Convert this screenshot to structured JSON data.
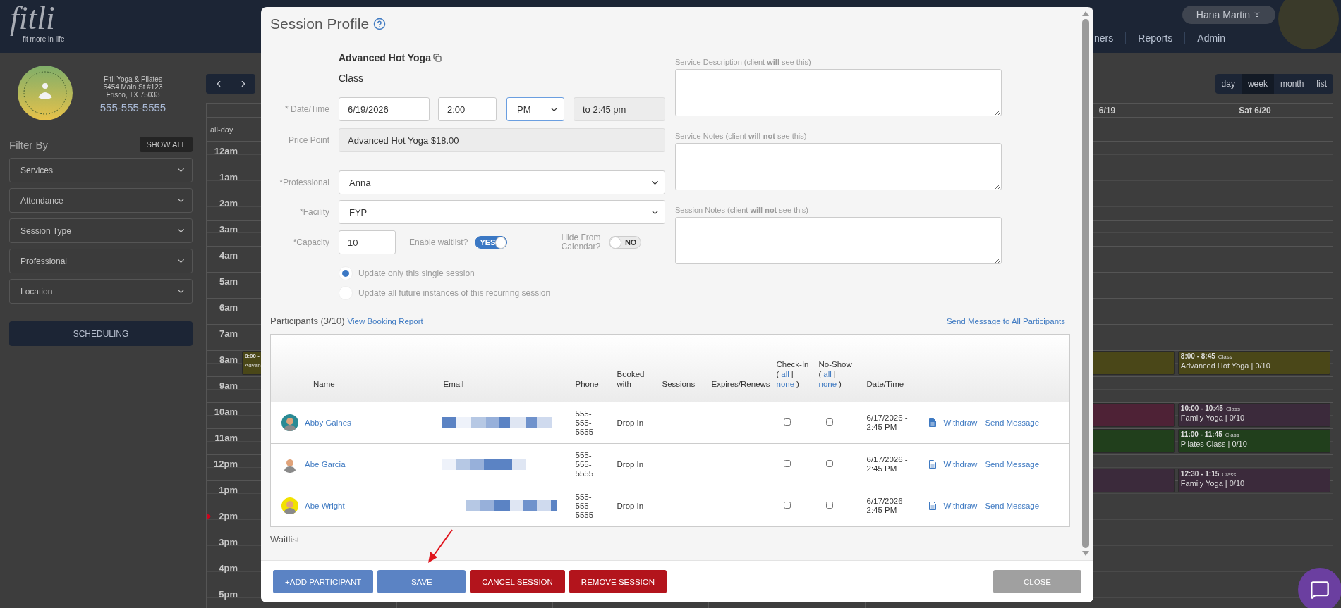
{
  "header": {
    "logo": "fitli",
    "tagline": "fit more in life",
    "nav": [
      {
        "label": "ners"
      },
      {
        "label": "Reports"
      },
      {
        "label": "Admin"
      }
    ],
    "user": "Hana Martin"
  },
  "business": {
    "name": "Fitli Yoga & Pilates",
    "address": [
      "5454 Main St #123",
      "Frisco, TX 75033"
    ],
    "phone": "555-555-5555"
  },
  "filters": {
    "title": "Filter By",
    "show_all": "SHOW ALL",
    "dropdowns": [
      "Services",
      "Attendance",
      "Session Type",
      "Professional",
      "Location"
    ]
  },
  "scheduling_button": "SCHEDULING",
  "calendar": {
    "views": [
      {
        "label": "day",
        "selected": false
      },
      {
        "label": "week",
        "selected": true
      },
      {
        "label": "month",
        "selected": false
      },
      {
        "label": "list",
        "selected": false
      }
    ],
    "day_headers": [
      "6/19",
      "Sat 6/20"
    ],
    "all_day": "all-day",
    "hours": [
      "12am",
      "1am",
      "2am",
      "3am",
      "4am",
      "5am",
      "6am",
      "7am",
      "8am",
      "9am",
      "10am",
      "11am",
      "12pm",
      "1pm",
      "2pm",
      "3pm",
      "4pm",
      "5pm"
    ],
    "events": [
      {
        "time": "8:00 -",
        "title": "Advan",
        "color": "#4a4718"
      },
      {
        "color": "#4a4718"
      },
      {
        "color": "#4e2236"
      },
      {
        "color": "#213f1c"
      },
      {
        "color": "#3b2a3b"
      },
      {
        "time": "8:00 - 8:45",
        "type": "Class",
        "title": "Advanced Hot Yoga | 0/10",
        "color": "#4a4718"
      },
      {
        "time": "10:00 - 10:45",
        "type": "Class",
        "title": "Family Yoga | 0/10",
        "color": "#3b2a3b"
      },
      {
        "time": "11:00 - 11:45",
        "type": "Class",
        "title": "Pilates Class | 0/10",
        "color": "#213f1c"
      },
      {
        "time": "12:30 - 1:15",
        "type": "Class",
        "title": "Family Yoga | 0/10",
        "color": "#3b2a3b"
      }
    ]
  },
  "modal": {
    "title": "Session Profile",
    "service": "Advanced Hot Yoga",
    "service_type": "Class",
    "date_label": "* Date/Time",
    "date": "6/19/2026",
    "time": "2:00",
    "ampm": "PM",
    "ampm_focused": true,
    "end": "to 2:45 pm",
    "price_label": "Price Point",
    "price": "Advanced Hot Yoga $18.00",
    "professional_label": "*Professional",
    "professional": "Anna",
    "facility_label": "*Facility",
    "facility": "FYP",
    "capacity_label": "*Capacity",
    "capacity": "10",
    "waitlist": {
      "label": "Enable waitlist?",
      "on": true,
      "text": "YES"
    },
    "hide_from_calendar": {
      "label": "Hide From Calendar?",
      "on": false,
      "text": "NO"
    },
    "update_options": [
      {
        "label": "Update only this single session",
        "selected": true
      },
      {
        "label": "Update all future instances of this recurring session",
        "selected": false
      }
    ],
    "notes": [
      {
        "label": "Service Description (client **will** see this)"
      },
      {
        "label": "Service Notes (client **will not** see this)"
      },
      {
        "label": "Session Notes (client **will not** see this)"
      }
    ],
    "participants": {
      "title": "Participants (3/10)",
      "report_link": "View Booking Report",
      "message_all": "Send Message to All Participants",
      "columns": [
        {
          "label": "Name"
        },
        {
          "label": "Email"
        },
        {
          "label": "Phone"
        },
        {
          "label": "Booked with"
        },
        {
          "label": "Sessions"
        },
        {
          "label": "Expires/Renews"
        },
        {
          "label": "Check-In",
          "open": "(",
          "links": [
            "all",
            "none"
          ],
          "sep": "|",
          "close": ")"
        },
        {
          "label": "No-Show",
          "open": "(",
          "links": [
            "all",
            "none"
          ],
          "sep": "|",
          "close": ")"
        },
        {
          "label": "Date/Time"
        }
      ],
      "rows": [
        {
          "name": "Abby Gaines",
          "phone": "555-555-5555",
          "booked_with": "Drop In",
          "checked_in": false,
          "no_show": false,
          "date": "6/17/2026 - 2:45 PM",
          "file_filled": true,
          "actions": [
            "Withdraw",
            "Send Message"
          ]
        },
        {
          "name": "Abe Garcia",
          "phone": "555-555-5555",
          "booked_with": "Drop In",
          "checked_in": false,
          "no_show": false,
          "date": "6/17/2026 - 2:45 PM",
          "file_filled": false,
          "actions": [
            "Withdraw",
            "Send Message"
          ]
        },
        {
          "name": "Abe Wright",
          "phone": "555-555-5555",
          "booked_with": "Drop In",
          "checked_in": false,
          "no_show": false,
          "date": "6/17/2026 - 2:45 PM",
          "file_filled": false,
          "actions": [
            "Withdraw",
            "Send Message"
          ]
        }
      ]
    },
    "waitlist_title": "Waitlist",
    "buttons": [
      {
        "label": "+ADD PARTICIPANT",
        "kind": "primary"
      },
      {
        "label": "SAVE",
        "kind": "primary"
      },
      {
        "label": "CANCEL SESSION",
        "kind": "danger"
      },
      {
        "label": "REMOVE SESSION",
        "kind": "danger"
      },
      {
        "label": "CLOSE",
        "kind": "close"
      }
    ]
  }
}
